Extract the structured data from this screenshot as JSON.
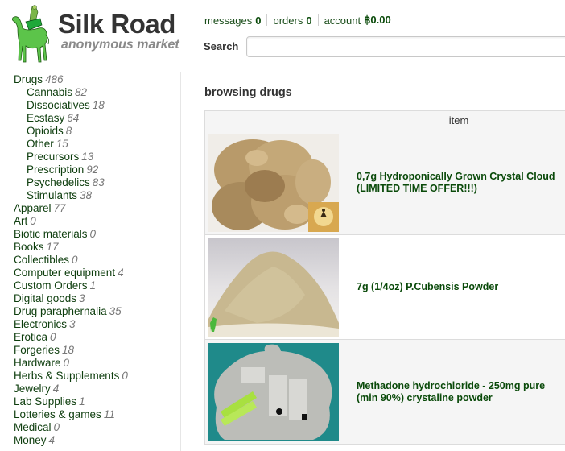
{
  "brand": {
    "title": "Silk Road",
    "subtitle": "anonymous market",
    "logo_icon": "camel-icon"
  },
  "topnav": [
    {
      "label": "messages",
      "value": "0"
    },
    {
      "label": "orders",
      "value": "0"
    },
    {
      "label": "account",
      "value": "฿0.00"
    }
  ],
  "search": {
    "label": "Search",
    "value": "",
    "placeholder": ""
  },
  "categories": [
    {
      "name": "Drugs",
      "count": "486",
      "sub": false
    },
    {
      "name": "Cannabis",
      "count": "82",
      "sub": true
    },
    {
      "name": "Dissociatives",
      "count": "18",
      "sub": true
    },
    {
      "name": "Ecstasy",
      "count": "64",
      "sub": true
    },
    {
      "name": "Opioids",
      "count": "8",
      "sub": true
    },
    {
      "name": "Other",
      "count": "15",
      "sub": true
    },
    {
      "name": "Precursors",
      "count": "13",
      "sub": true
    },
    {
      "name": "Prescription",
      "count": "92",
      "sub": true
    },
    {
      "name": "Psychedelics",
      "count": "83",
      "sub": true
    },
    {
      "name": "Stimulants",
      "count": "38",
      "sub": true
    },
    {
      "name": "Apparel",
      "count": "77",
      "sub": false
    },
    {
      "name": "Art",
      "count": "0",
      "sub": false
    },
    {
      "name": "Biotic materials",
      "count": "0",
      "sub": false
    },
    {
      "name": "Books",
      "count": "17",
      "sub": false
    },
    {
      "name": "Collectibles",
      "count": "0",
      "sub": false
    },
    {
      "name": "Computer equipment",
      "count": "4",
      "sub": false
    },
    {
      "name": "Custom Orders",
      "count": "1",
      "sub": false
    },
    {
      "name": "Digital goods",
      "count": "3",
      "sub": false
    },
    {
      "name": "Drug paraphernalia",
      "count": "35",
      "sub": false
    },
    {
      "name": "Electronics",
      "count": "3",
      "sub": false
    },
    {
      "name": "Erotica",
      "count": "0",
      "sub": false
    },
    {
      "name": "Forgeries",
      "count": "18",
      "sub": false
    },
    {
      "name": "Hardware",
      "count": "0",
      "sub": false
    },
    {
      "name": "Herbs & Supplements",
      "count": "0",
      "sub": false
    },
    {
      "name": "Jewelry",
      "count": "4",
      "sub": false
    },
    {
      "name": "Lab Supplies",
      "count": "1",
      "sub": false
    },
    {
      "name": "Lotteries & games",
      "count": "11",
      "sub": false
    },
    {
      "name": "Medical",
      "count": "0",
      "sub": false
    },
    {
      "name": "Money",
      "count": "4",
      "sub": false
    }
  ],
  "main": {
    "title": "browsing drugs",
    "table_header": "item",
    "items": [
      {
        "title": "0,7g Hydroponically Grown Crystal Cloud (LIMITED TIME OFFER!!!)",
        "image": "cannabis-buds-photo"
      },
      {
        "title": "7g (1/4oz) P.Cubensis Powder",
        "image": "powder-pile-photo"
      },
      {
        "title": "Methadone hydrochloride - 250mg pure (min 90%) crystaline powder",
        "image": "packaged-vials-photo"
      }
    ]
  },
  "colors": {
    "link_green": "#0d3d0d",
    "camel_green": "#5cc44a",
    "count_gray": "#777777"
  }
}
